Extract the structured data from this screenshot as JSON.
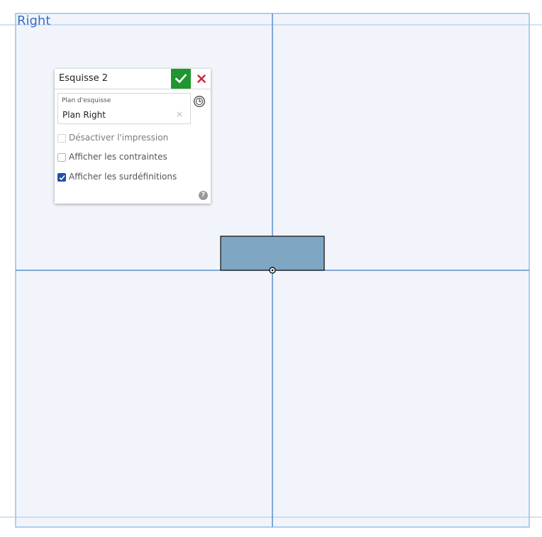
{
  "viewport": {
    "plane_label": "Right"
  },
  "sketch_panel": {
    "title": "Esquisse 2",
    "accept_icon": "checkmark-icon",
    "cancel_icon": "close-icon",
    "sketch_plane": {
      "label": "Plan d'esquisse",
      "value": "Plan Right",
      "clear_glyph": "×"
    },
    "history_icon": "clock-icon",
    "options": [
      {
        "label": "Désactiver l'impression",
        "checked": false,
        "enabled": false
      },
      {
        "label": "Afficher les contraintes",
        "checked": false,
        "enabled": true
      },
      {
        "label": "Afficher les surdéfinitions",
        "checked": true,
        "enabled": true
      }
    ],
    "help_glyph": "?"
  },
  "colors": {
    "plane_fill": "#f1f5fb",
    "plane_border": "#9dbde6",
    "axis_line": "#5b8fcf",
    "sketch_fill": "#7fa6c3",
    "accept_green": "#1f9630",
    "cancel_red": "#c8283a",
    "label_blue": "#3a6fc4"
  }
}
